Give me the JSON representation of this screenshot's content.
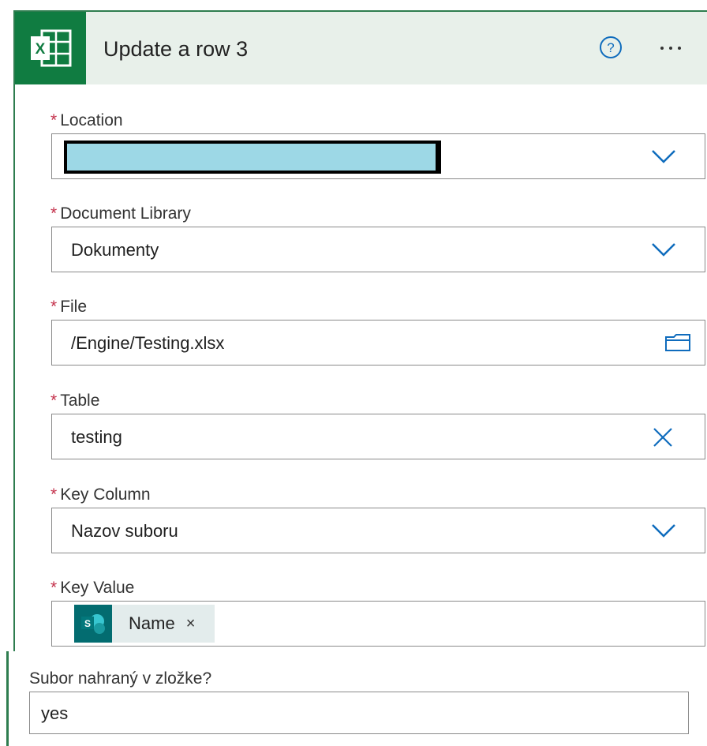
{
  "header": {
    "title": "Update a row 3",
    "brand_color": "#107c41",
    "header_bg": "#e8f0ea",
    "icon": "excel-icon",
    "help_icon": "help-icon",
    "more_icon": "more-options-icon"
  },
  "required_marker": "*",
  "fields": {
    "location": {
      "label": "Location",
      "value": "",
      "icon": "chevron-down-icon"
    },
    "document_library": {
      "label": "Document Library",
      "value": "Dokumenty",
      "icon": "chevron-down-icon"
    },
    "file": {
      "label": "File",
      "value": "/Engine/Testing.xlsx",
      "icon": "folder-icon"
    },
    "table": {
      "label": "Table",
      "value": "testing",
      "icon": "clear-icon"
    },
    "key_column": {
      "label": "Key Column",
      "value": "Nazov suboru",
      "icon": "chevron-down-icon"
    },
    "key_value": {
      "label": "Key Value",
      "token": {
        "label": "Name",
        "remove": "×",
        "icon": "sharepoint-icon",
        "color": "#036c70"
      }
    }
  },
  "sub_field": {
    "label": "Subor nahraný v zložke?",
    "value": "yes"
  },
  "colors": {
    "accent": "#0f6cbd",
    "required": "#c4314b",
    "border": "#2e7d4f"
  }
}
